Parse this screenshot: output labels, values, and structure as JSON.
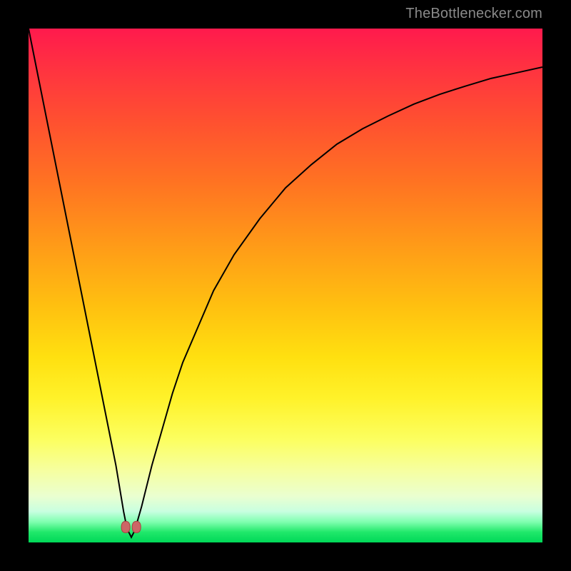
{
  "watermark": "TheBottlenecker.com",
  "chart_data": {
    "type": "line",
    "title": "",
    "xlabel": "",
    "ylabel": "",
    "xlim": [
      0,
      100
    ],
    "ylim": [
      0,
      100
    ],
    "grid": false,
    "legend": false,
    "series": [
      {
        "name": "curve",
        "x": [
          0,
          2,
          4,
          6,
          8,
          10,
          12,
          14,
          15,
          16,
          17,
          18,
          18.5,
          19,
          19.5,
          20,
          20.5,
          21,
          22,
          23,
          24,
          26,
          28,
          30,
          33,
          36,
          40,
          45,
          50,
          55,
          60,
          65,
          70,
          75,
          80,
          85,
          90,
          95,
          100
        ],
        "values": [
          100,
          90,
          80,
          70,
          60,
          50,
          40,
          30,
          25,
          20,
          15,
          9,
          6,
          3.5,
          2,
          1,
          2,
          3.5,
          7,
          11,
          15,
          22,
          29,
          35,
          42,
          49,
          56,
          63,
          69,
          73.5,
          77.5,
          80.5,
          83,
          85.3,
          87.2,
          88.8,
          90.3,
          91.4,
          92.5
        ]
      }
    ],
    "markers": [
      {
        "name": "left-marker",
        "x": 18.9,
        "y": 3.0
      },
      {
        "name": "right-marker",
        "x": 21.0,
        "y": 3.0
      }
    ]
  }
}
